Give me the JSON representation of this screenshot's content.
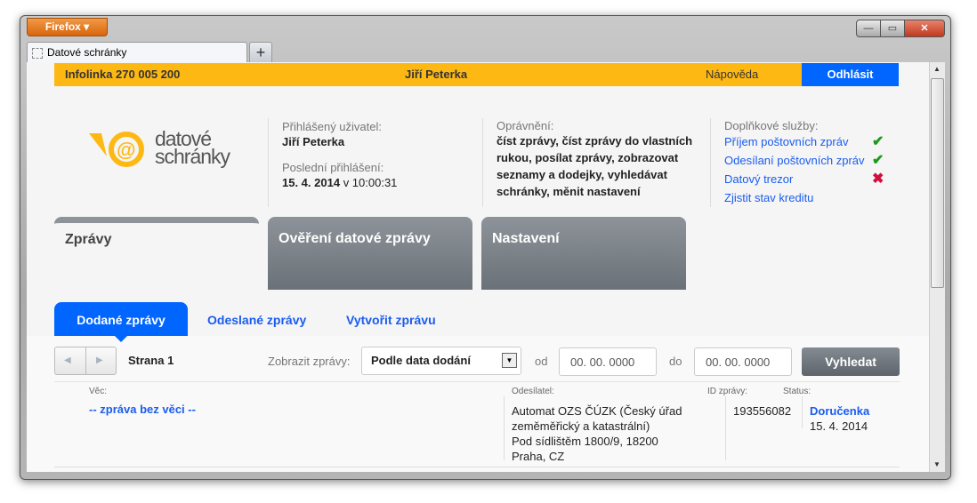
{
  "browser": {
    "menu_label": "Firefox",
    "tab_title": "Datové schránky",
    "new_tab": "+",
    "minimize": "—",
    "maximize": "▭",
    "close": "✕"
  },
  "topbar": {
    "hotline": "Infolinka 270 005 200",
    "user": "Jiří Peterka",
    "help": "Nápověda",
    "logout": "Odhlásit"
  },
  "logo": {
    "line1": "datové",
    "line2": "schránky"
  },
  "info": {
    "user_label": "Přihlášený uživatel:",
    "user_name": "Jiří Peterka",
    "last_login_label": "Poslední přihlášení:",
    "last_login_date": "15. 4. 2014",
    "last_login_time": "v 10:00:31"
  },
  "permissions": {
    "label": "Oprávnění:",
    "text": "číst zprávy, číst zprávy do vlastních rukou, posílat zprávy, zobrazovat seznamy a dodejky, vyhledávat schránky, měnit nastavení"
  },
  "services": {
    "label": "Doplňkové služby:",
    "items": [
      {
        "label": "Příjem poštovních zpráv",
        "status": "✔"
      },
      {
        "label": "Odesílaní poštovních zpráv",
        "status": "✔"
      },
      {
        "label": "Datový trezor",
        "status": "✖"
      }
    ],
    "credit": "Zjistit stav kreditu"
  },
  "main_tabs": [
    "Zprávy",
    "Ověření datové zprávy",
    "Nastavení"
  ],
  "sub_tabs": [
    "Dodané zprávy",
    "Odeslané zprávy",
    "Vytvořit zprávu"
  ],
  "toolbar": {
    "prev": "◀",
    "next": "▶",
    "page": "Strana 1",
    "show_label": "Zobrazit zprávy:",
    "show_value": "Podle data dodání",
    "from_label": "od",
    "from_value": "00. 00. 0000",
    "to_label": "do",
    "to_value": "00. 00. 0000",
    "search": "Vyhledat"
  },
  "table": {
    "headers": {
      "subject": "Věc:",
      "sender": "Odesílatel:",
      "id": "ID zprávy:",
      "status": "Status:"
    },
    "rows": [
      {
        "subject": "-- zpráva bez věci --",
        "sender": [
          "Automat OZS ČÚZK (Český úřad",
          "zeměměřický a katastrální)",
          "Pod sídlištěm 1800/9, 18200",
          "Praha, CZ"
        ],
        "id": "193556082",
        "status": "Doručenka",
        "status_date": "15. 4. 2014"
      }
    ]
  },
  "colors": {
    "yellow": "#fdb813",
    "blue": "#0066ff",
    "check": "#1a9a1a",
    "cross": "#d0103a"
  }
}
